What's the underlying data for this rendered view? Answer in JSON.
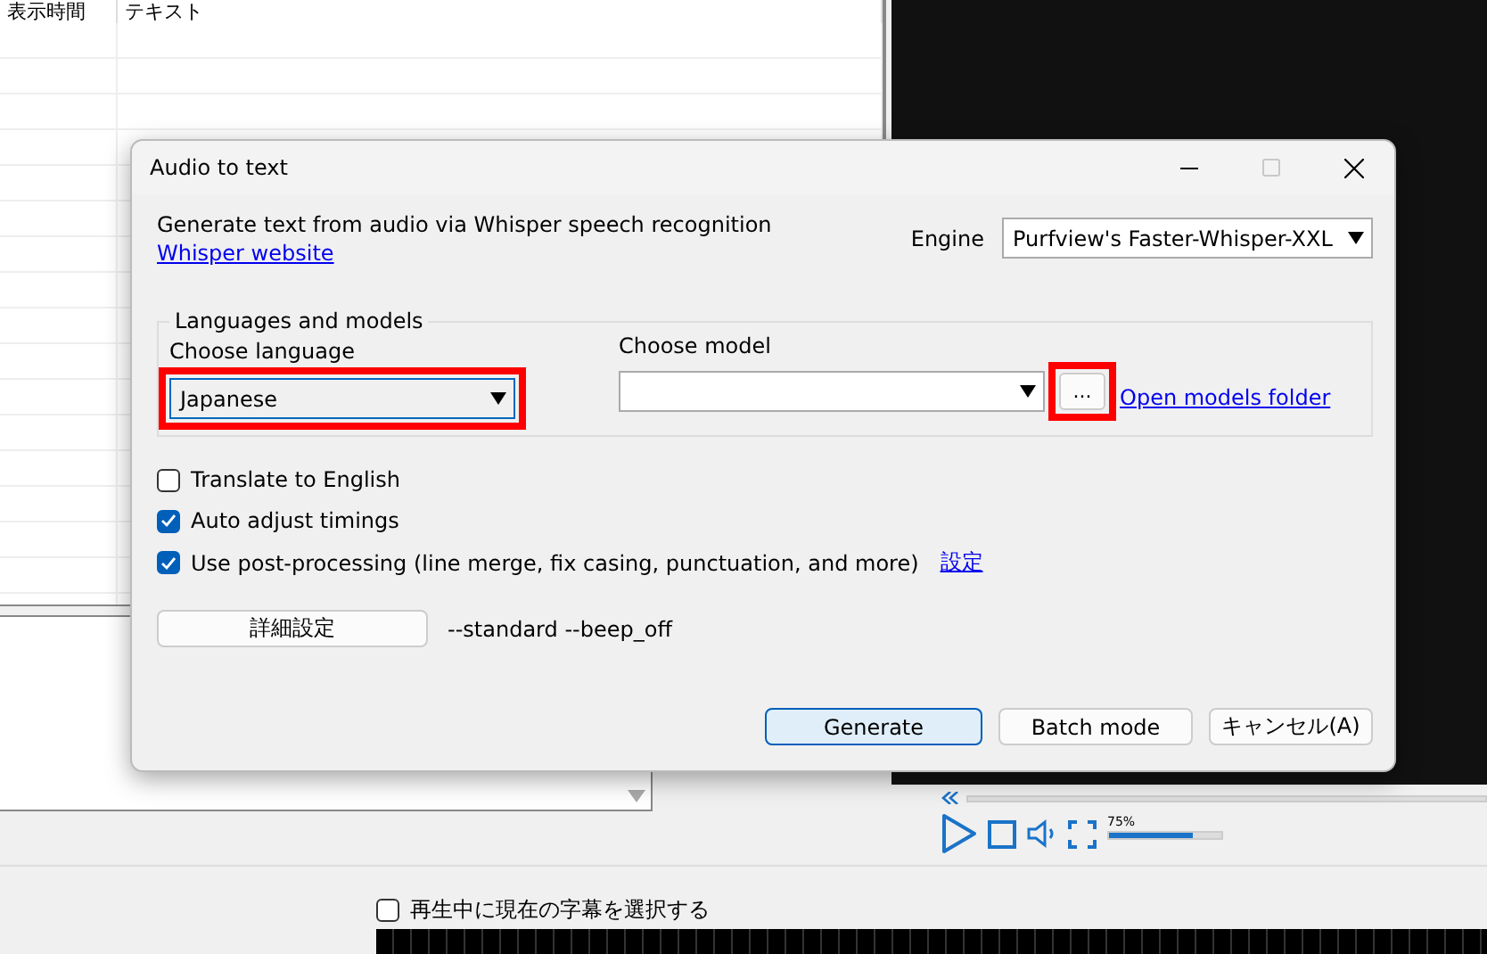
{
  "table": {
    "columns": [
      "表示時間",
      "テキスト"
    ]
  },
  "player": {
    "volume": {
      "level": 0.75,
      "reading": "75%"
    }
  },
  "sync_option": {
    "label": "再生中に現在の字幕を選択する",
    "checked": false
  },
  "dialog": {
    "title": "Audio to text",
    "maximize_disabled": true,
    "description": "Generate text from audio via Whisper speech recognition",
    "website_link": "Whisper website",
    "engine": {
      "label": "Engine",
      "value": "Purfview's Faster-Whisper-XXL"
    },
    "group": {
      "legend": "Languages and models",
      "language": {
        "label": "Choose language",
        "value": "Japanese",
        "highlighted": true
      },
      "model": {
        "label": "Choose model"
      },
      "browse": {
        "label": "...",
        "highlighted": true
      },
      "folder_link": "Open models folder"
    },
    "options": [
      {
        "label": "Translate to English",
        "checked": false
      },
      {
        "label": "Auto adjust timings",
        "checked": true
      },
      {
        "label": "Use post-processing (line merge, fix casing, punctuation, and more)",
        "checked": true,
        "link": "設定"
      }
    ],
    "advanced_button": "詳細設定",
    "arguments": "--standard --beep_off",
    "buttons": [
      {
        "label": "Generate",
        "primary": true
      },
      {
        "label": "Batch mode",
        "primary": false
      },
      {
        "label": "キャンセル(A)",
        "primary": false
      }
    ]
  }
}
